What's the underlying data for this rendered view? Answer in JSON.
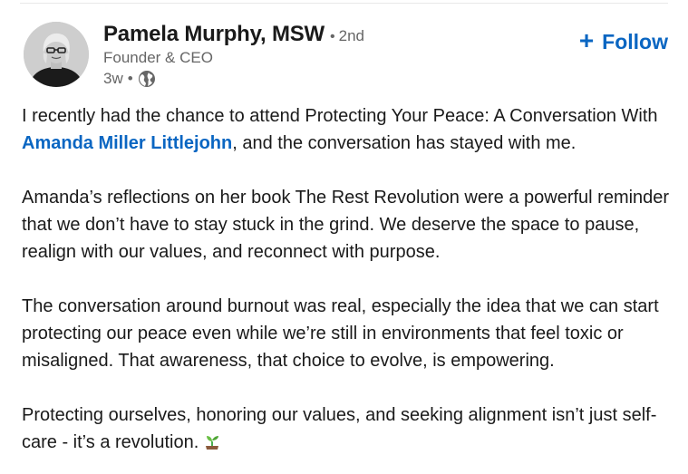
{
  "post": {
    "author": {
      "name": "Pamela Murphy, MSW",
      "degree_separator": "•",
      "degree": "2nd",
      "headline": "Founder & CEO",
      "time_ago": "3w",
      "meta_separator": "•",
      "visibility_icon": "globe-icon"
    },
    "follow": {
      "icon": "+",
      "label": "Follow"
    },
    "body": {
      "p1_before": "I recently had the chance to attend Protecting Your Peace: A Conversation With ",
      "p1_mention": "Amanda Miller Littlejohn",
      "p1_after": ", and the conversation has stayed with me.",
      "p2": "Amanda’s reflections on her book The Rest Revolution were a powerful reminder that we don’t have to stay stuck in the grind. We deserve the space to pause, realign with our values, and reconnect with purpose.",
      "p3": "The conversation around burnout was real, especially the idea that we can start protecting our peace even while we’re still in environments that feel toxic or misaligned. That awareness, that choice to evolve, is empowering.",
      "p4": "Protecting ourselves, honoring our values, and seeking alignment isn’t just self-care - it’s a revolution.",
      "p4_emoji_icon": "sprout-icon"
    }
  },
  "colors": {
    "link_blue": "#0a66c2",
    "text_primary": "#1a1a1a",
    "text_secondary": "#666666"
  }
}
